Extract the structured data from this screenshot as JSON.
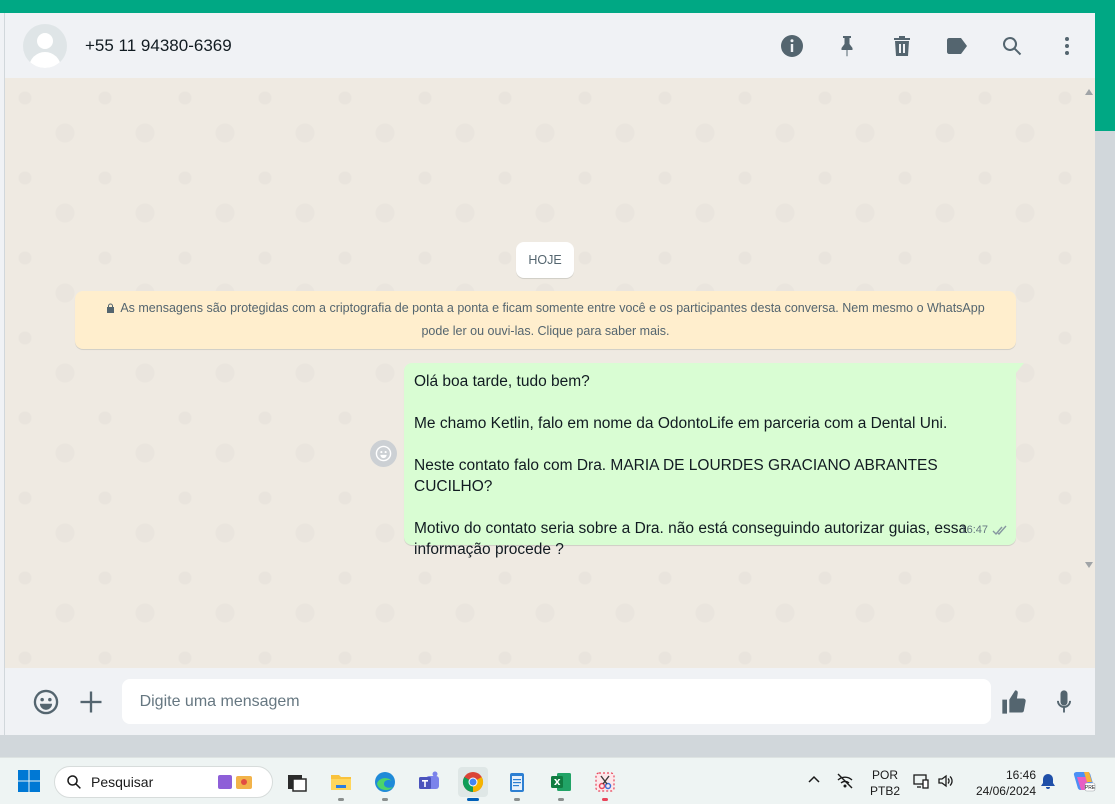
{
  "chat": {
    "contact_name": "+55 11 94380-6369",
    "date_chip": "HOJE",
    "encryption_notice": "As mensagens são protegidas com a criptografia de ponta a ponta e ficam somente entre você e os participantes desta conversa. Nem mesmo o WhatsApp pode ler ou ouvi-las. Clique para saber mais.",
    "message": {
      "line1": "Olá boa tarde, tudo bem?",
      "line2": "Me chamo Ketlin, falo em nome da OdontoLife em parceria com a Dental Uni.",
      "line3": "Neste contato falo com Dra. MARIA DE LOURDES GRACIANO ABRANTES CUCILHO?",
      "line4": "Motivo do contato seria sobre a Dra. não está conseguindo autorizar guias, essa informação procede ?",
      "time": "16:47"
    }
  },
  "composer": {
    "placeholder": "Digite uma mensagem"
  },
  "taskbar": {
    "search_label": "Pesquisar",
    "lang_line1": "POR",
    "lang_line2": "PTB2",
    "time": "16:46",
    "date": "24/06/2024"
  },
  "colors": {
    "accent": "#00a884",
    "outgoing_bubble": "#d9fdd3",
    "notice_bg": "#ffeecd",
    "chat_bg": "#efeae2"
  },
  "icons": [
    "info-icon",
    "pin-icon",
    "trash-icon",
    "label-icon",
    "search-icon",
    "menu-dots-icon",
    "emoji-icon",
    "plus-icon",
    "thumbs-up-icon",
    "mic-icon",
    "lock-icon",
    "double-check-icon"
  ]
}
